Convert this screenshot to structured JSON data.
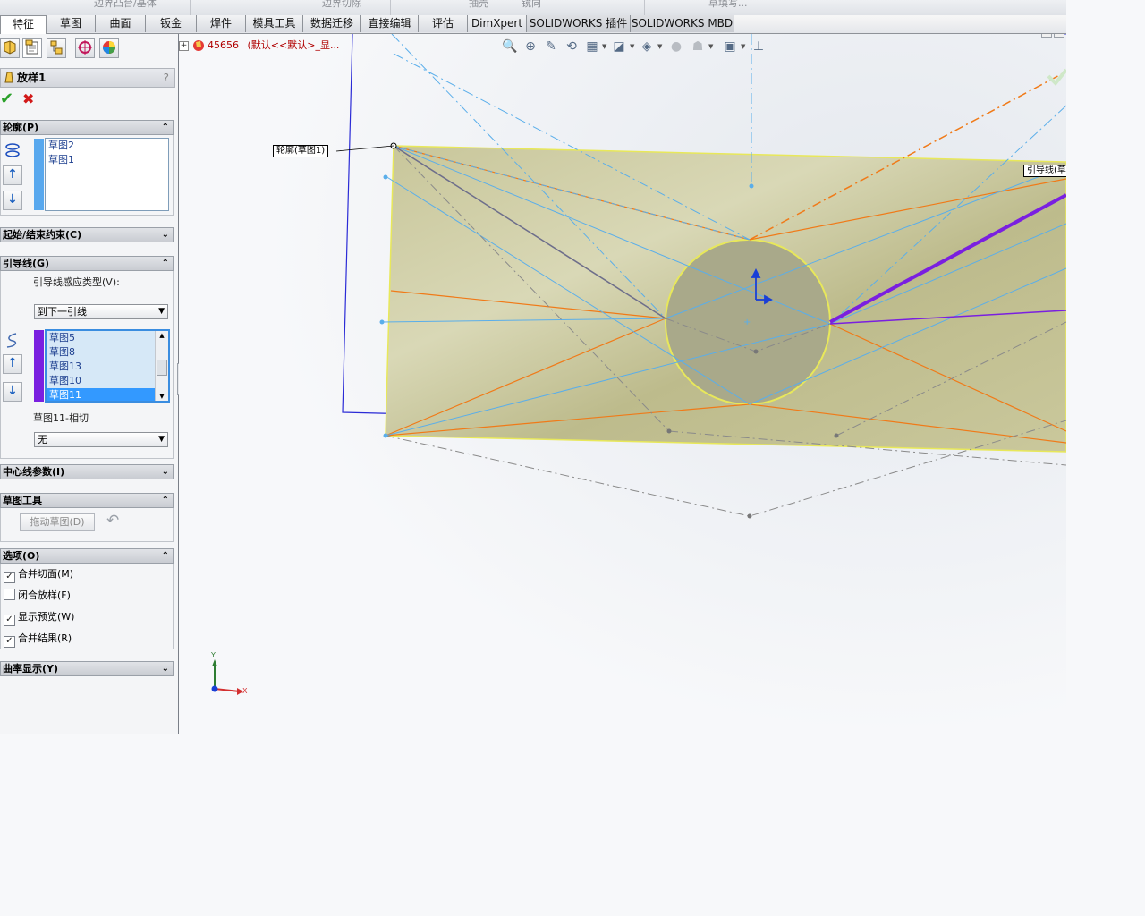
{
  "top_toolbar": {
    "items": [
      "边界凸台/基体",
      "边界切除",
      "抽壳",
      "镜向",
      "草填写..."
    ]
  },
  "tabs": [
    {
      "label": "特征",
      "active": true
    },
    {
      "label": "草图"
    },
    {
      "label": "曲面"
    },
    {
      "label": "钣金"
    },
    {
      "label": "焊件"
    },
    {
      "label": "模具工具"
    },
    {
      "label": "数据迁移"
    },
    {
      "label": "直接编辑"
    },
    {
      "label": "评估"
    },
    {
      "label": "DimXpert"
    },
    {
      "label": "SOLIDWORKS 插件"
    },
    {
      "label": "SOLIDWORKS MBD"
    }
  ],
  "property_manager": {
    "icon_tabs": [
      "feature-manager-icon",
      "property-manager-icon",
      "configuration-manager-icon",
      "dimxpert-manager-icon",
      "display-manager-icon"
    ],
    "title": "放样1",
    "help": "?",
    "ok": "✔",
    "cancel": "✖",
    "profiles": {
      "header": "轮廓(P)",
      "items": [
        "草图2",
        "草图1"
      ]
    },
    "start_end_constraints": {
      "header": "起始/结束约束(C)"
    },
    "guides": {
      "header": "引导线(G)",
      "influence_label": "引导线感应类型(V):",
      "influence_value": "到下一引线",
      "items": [
        "草图5",
        "草图8",
        "草图13",
        "草图10",
        "草图11"
      ],
      "selected_item": "草图11",
      "tangency_label": "草图11-相切",
      "tangency_value": "无"
    },
    "centerline": {
      "header": "中心线参数(I)"
    },
    "sketch_tools": {
      "header": "草图工具",
      "drag_button": "拖动草图(D)"
    },
    "options": {
      "header": "选项(O)",
      "checks": [
        {
          "label": "合并切面(M)",
          "checked": "✓"
        },
        {
          "label": "闭合放样(F)",
          "checked": ""
        },
        {
          "label": "显示预览(W)",
          "checked": "✓"
        },
        {
          "label": "合并结果(R)",
          "checked": "✓"
        }
      ]
    },
    "curvature": {
      "header": "曲率显示(Y)"
    }
  },
  "graphics": {
    "tree_part": "45656",
    "tree_config": "(默认<<默认>_显...",
    "callout_profile": "轮廓(草图1)",
    "callout_guide": "引导线(草",
    "triad": {
      "x": "X",
      "y": "Y"
    },
    "colors": {
      "face": "#c9c79a",
      "edge_yellow": "#e8e85a",
      "guide_purple": "#7a1fe0",
      "orange": "#f07a18",
      "light_blue": "#5aaeea",
      "plane_blue": "#2b2bd6"
    }
  }
}
